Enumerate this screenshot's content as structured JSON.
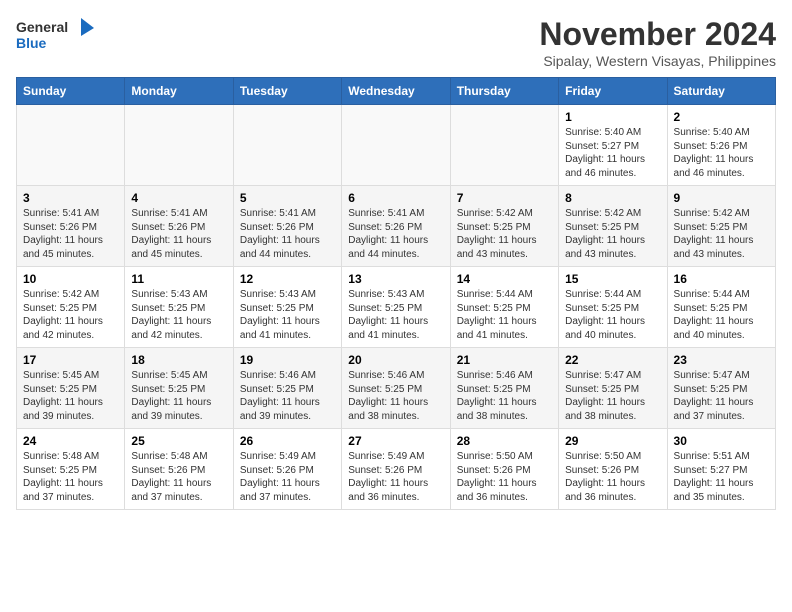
{
  "logo": {
    "text_general": "General",
    "text_blue": "Blue"
  },
  "header": {
    "month_year": "November 2024",
    "location": "Sipalay, Western Visayas, Philippines"
  },
  "weekdays": [
    "Sunday",
    "Monday",
    "Tuesday",
    "Wednesday",
    "Thursday",
    "Friday",
    "Saturday"
  ],
  "weeks": [
    [
      {
        "day": "",
        "info": ""
      },
      {
        "day": "",
        "info": ""
      },
      {
        "day": "",
        "info": ""
      },
      {
        "day": "",
        "info": ""
      },
      {
        "day": "",
        "info": ""
      },
      {
        "day": "1",
        "info": "Sunrise: 5:40 AM\nSunset: 5:27 PM\nDaylight: 11 hours and 46 minutes."
      },
      {
        "day": "2",
        "info": "Sunrise: 5:40 AM\nSunset: 5:26 PM\nDaylight: 11 hours and 46 minutes."
      }
    ],
    [
      {
        "day": "3",
        "info": "Sunrise: 5:41 AM\nSunset: 5:26 PM\nDaylight: 11 hours and 45 minutes."
      },
      {
        "day": "4",
        "info": "Sunrise: 5:41 AM\nSunset: 5:26 PM\nDaylight: 11 hours and 45 minutes."
      },
      {
        "day": "5",
        "info": "Sunrise: 5:41 AM\nSunset: 5:26 PM\nDaylight: 11 hours and 44 minutes."
      },
      {
        "day": "6",
        "info": "Sunrise: 5:41 AM\nSunset: 5:26 PM\nDaylight: 11 hours and 44 minutes."
      },
      {
        "day": "7",
        "info": "Sunrise: 5:42 AM\nSunset: 5:25 PM\nDaylight: 11 hours and 43 minutes."
      },
      {
        "day": "8",
        "info": "Sunrise: 5:42 AM\nSunset: 5:25 PM\nDaylight: 11 hours and 43 minutes."
      },
      {
        "day": "9",
        "info": "Sunrise: 5:42 AM\nSunset: 5:25 PM\nDaylight: 11 hours and 43 minutes."
      }
    ],
    [
      {
        "day": "10",
        "info": "Sunrise: 5:42 AM\nSunset: 5:25 PM\nDaylight: 11 hours and 42 minutes."
      },
      {
        "day": "11",
        "info": "Sunrise: 5:43 AM\nSunset: 5:25 PM\nDaylight: 11 hours and 42 minutes."
      },
      {
        "day": "12",
        "info": "Sunrise: 5:43 AM\nSunset: 5:25 PM\nDaylight: 11 hours and 41 minutes."
      },
      {
        "day": "13",
        "info": "Sunrise: 5:43 AM\nSunset: 5:25 PM\nDaylight: 11 hours and 41 minutes."
      },
      {
        "day": "14",
        "info": "Sunrise: 5:44 AM\nSunset: 5:25 PM\nDaylight: 11 hours and 41 minutes."
      },
      {
        "day": "15",
        "info": "Sunrise: 5:44 AM\nSunset: 5:25 PM\nDaylight: 11 hours and 40 minutes."
      },
      {
        "day": "16",
        "info": "Sunrise: 5:44 AM\nSunset: 5:25 PM\nDaylight: 11 hours and 40 minutes."
      }
    ],
    [
      {
        "day": "17",
        "info": "Sunrise: 5:45 AM\nSunset: 5:25 PM\nDaylight: 11 hours and 39 minutes."
      },
      {
        "day": "18",
        "info": "Sunrise: 5:45 AM\nSunset: 5:25 PM\nDaylight: 11 hours and 39 minutes."
      },
      {
        "day": "19",
        "info": "Sunrise: 5:46 AM\nSunset: 5:25 PM\nDaylight: 11 hours and 39 minutes."
      },
      {
        "day": "20",
        "info": "Sunrise: 5:46 AM\nSunset: 5:25 PM\nDaylight: 11 hours and 38 minutes."
      },
      {
        "day": "21",
        "info": "Sunrise: 5:46 AM\nSunset: 5:25 PM\nDaylight: 11 hours and 38 minutes."
      },
      {
        "day": "22",
        "info": "Sunrise: 5:47 AM\nSunset: 5:25 PM\nDaylight: 11 hours and 38 minutes."
      },
      {
        "day": "23",
        "info": "Sunrise: 5:47 AM\nSunset: 5:25 PM\nDaylight: 11 hours and 37 minutes."
      }
    ],
    [
      {
        "day": "24",
        "info": "Sunrise: 5:48 AM\nSunset: 5:25 PM\nDaylight: 11 hours and 37 minutes."
      },
      {
        "day": "25",
        "info": "Sunrise: 5:48 AM\nSunset: 5:26 PM\nDaylight: 11 hours and 37 minutes."
      },
      {
        "day": "26",
        "info": "Sunrise: 5:49 AM\nSunset: 5:26 PM\nDaylight: 11 hours and 37 minutes."
      },
      {
        "day": "27",
        "info": "Sunrise: 5:49 AM\nSunset: 5:26 PM\nDaylight: 11 hours and 36 minutes."
      },
      {
        "day": "28",
        "info": "Sunrise: 5:50 AM\nSunset: 5:26 PM\nDaylight: 11 hours and 36 minutes."
      },
      {
        "day": "29",
        "info": "Sunrise: 5:50 AM\nSunset: 5:26 PM\nDaylight: 11 hours and 36 minutes."
      },
      {
        "day": "30",
        "info": "Sunrise: 5:51 AM\nSunset: 5:27 PM\nDaylight: 11 hours and 35 minutes."
      }
    ]
  ]
}
